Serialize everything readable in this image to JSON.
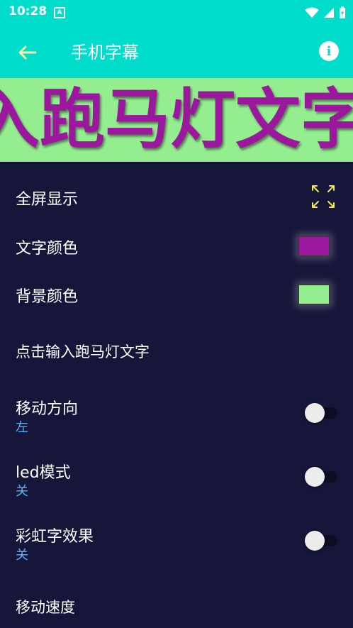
{
  "status": {
    "time": "10:28",
    "notification_icon": "A"
  },
  "app_bar": {
    "title": "手机字幕",
    "back_icon": "arrow-left-icon",
    "info_icon": "info-icon",
    "info_glyph": "i"
  },
  "marquee": {
    "text": "入跑马灯文字",
    "text_color": "#9b179e",
    "background_color": "#94ee90"
  },
  "settings": {
    "fullscreen": {
      "label": "全屏显示",
      "icon": "fullscreen-icon"
    },
    "text_color": {
      "label": "文字颜色",
      "value": "#9b179e"
    },
    "bg_color": {
      "label": "背景颜色",
      "value": "#94ee90"
    },
    "input_text": {
      "label": "点击输入跑马灯文字"
    },
    "direction": {
      "label": "移动方向",
      "value": "左",
      "enabled": false
    },
    "led_mode": {
      "label": "led模式",
      "value": "关",
      "enabled": false
    },
    "rainbow": {
      "label": "彩虹字效果",
      "value": "关",
      "enabled": false
    },
    "speed": {
      "label": "移动速度"
    }
  },
  "colors": {
    "accent": "#01ddcb",
    "background": "#16153a",
    "subtext": "#5fb4f5"
  }
}
